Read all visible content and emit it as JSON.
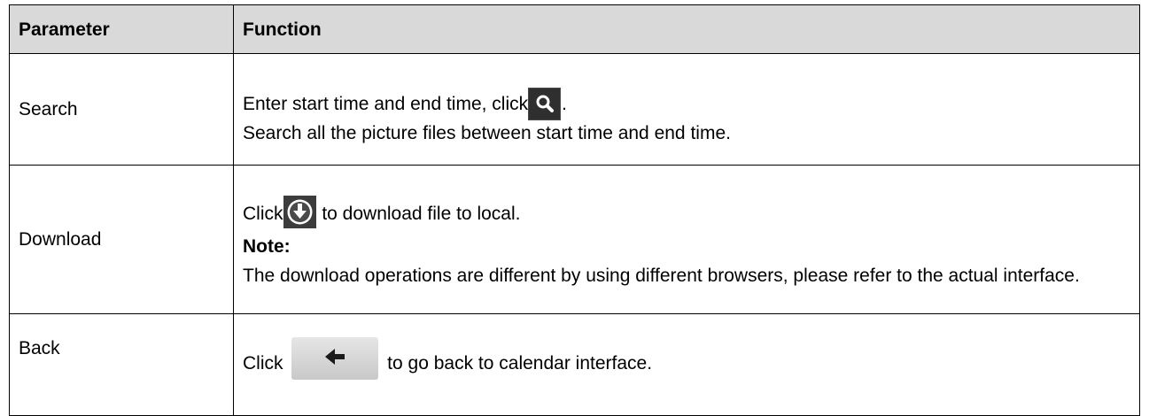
{
  "table": {
    "header": {
      "parameter": "Parameter",
      "function": "Function"
    },
    "rows": [
      {
        "parameter": "Search",
        "line1_before": "Enter start time and end time, click",
        "line1_after": ".",
        "line2": "Search all the picture files between start time and end time."
      },
      {
        "parameter": "Download",
        "line1_before": "Click",
        "line1_after": " to download file to local.",
        "note_label": "Note:",
        "note_text": "The download operations are different by using different browsers, please refer to the actual interface."
      },
      {
        "parameter": "Back",
        "line1_before": "Click ",
        "line1_after": " to go back to calendar interface."
      }
    ]
  },
  "icons": {
    "search": "search-icon",
    "download": "download-icon",
    "back": "back-arrow-icon"
  }
}
